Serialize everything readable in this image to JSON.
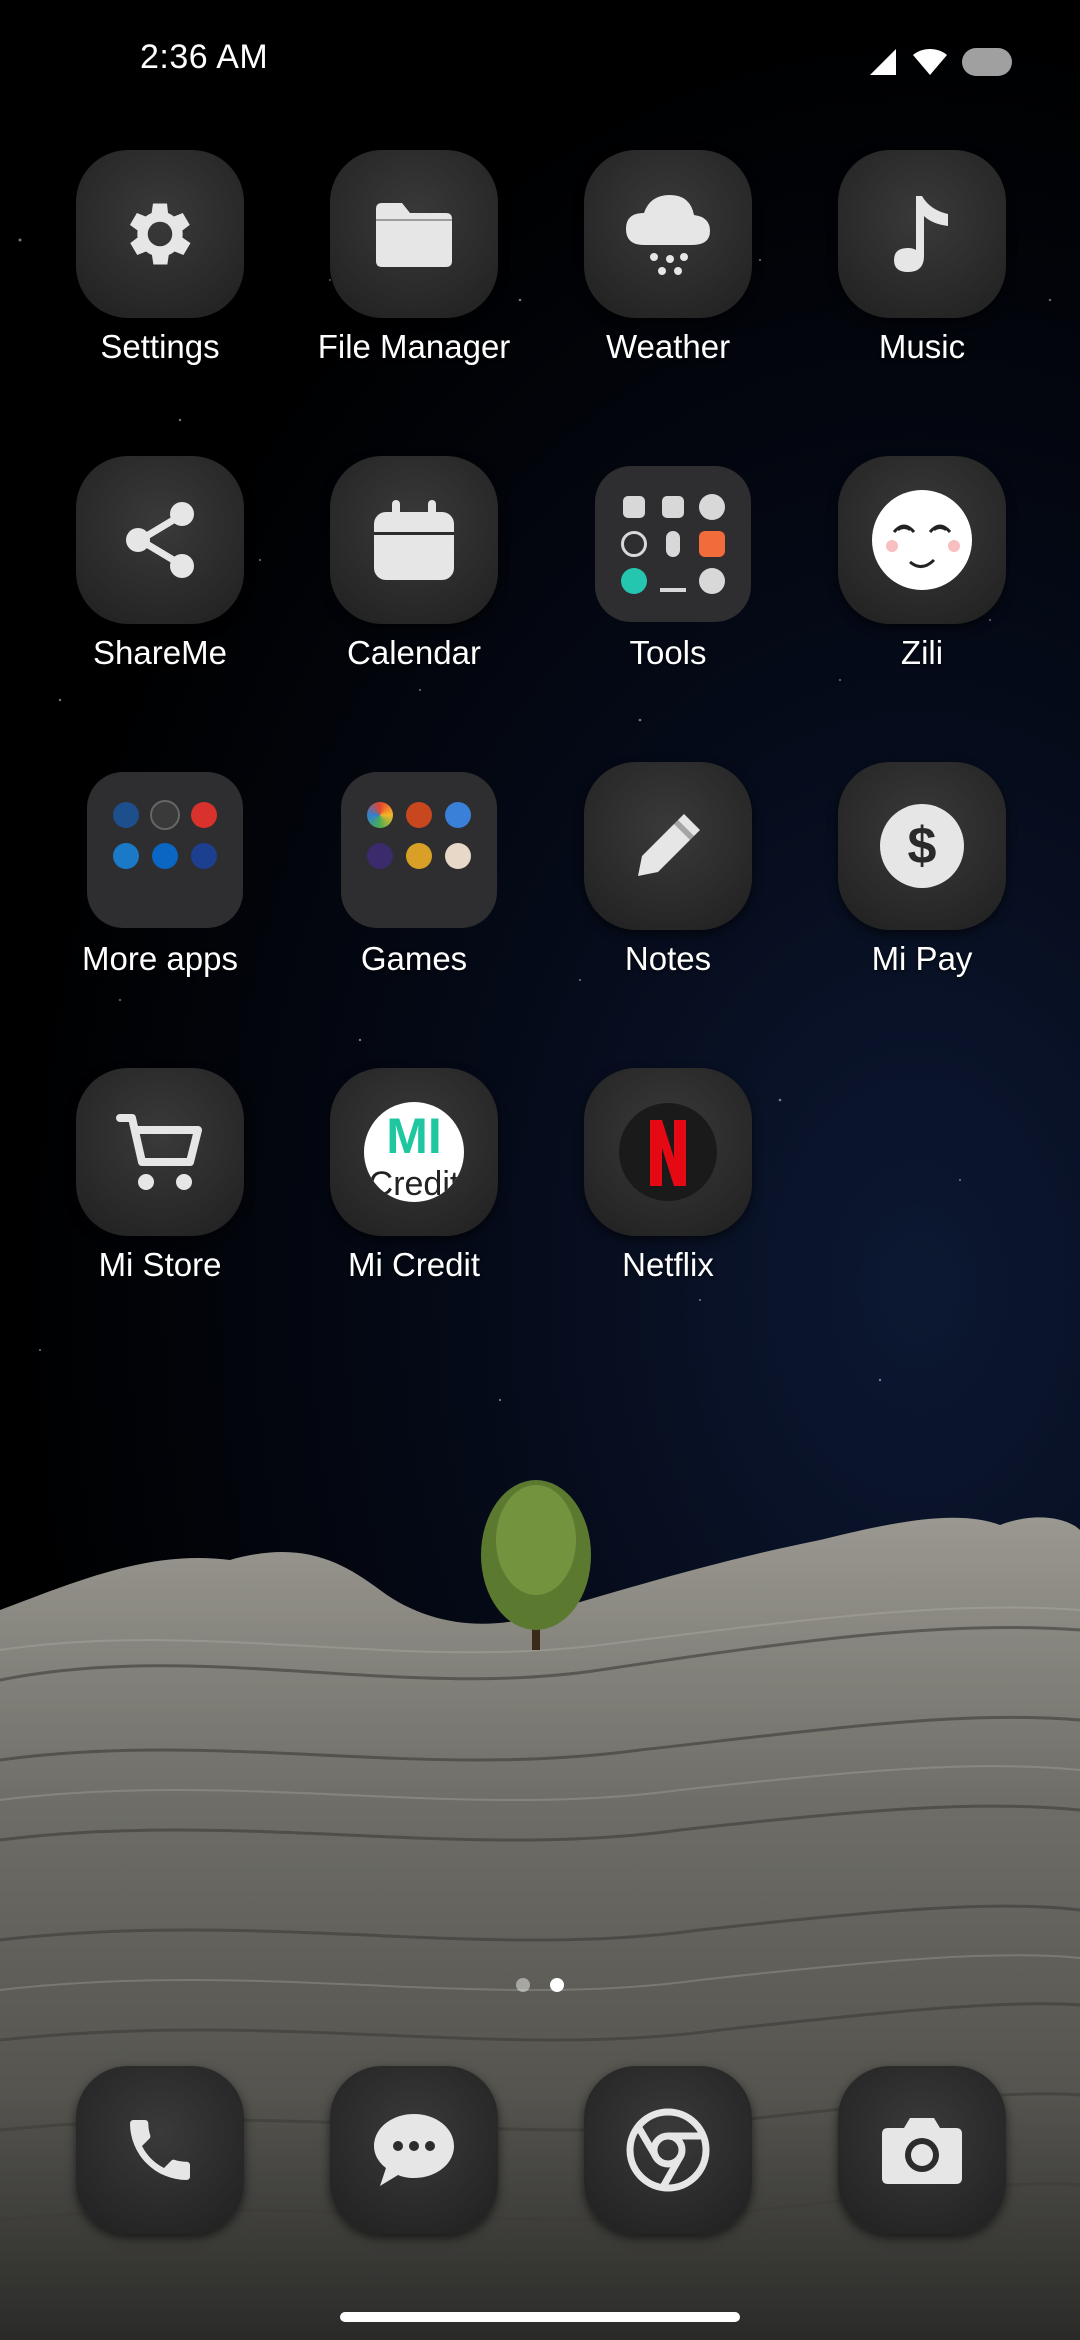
{
  "status_bar": {
    "time": "2:36 AM"
  },
  "apps": [
    {
      "name": "settings",
      "label": "Settings",
      "icon": "gear-icon"
    },
    {
      "name": "file-manager",
      "label": "File Manager",
      "icon": "folder-icon"
    },
    {
      "name": "weather",
      "label": "Weather",
      "icon": "cloud-snow-icon"
    },
    {
      "name": "music",
      "label": "Music",
      "icon": "music-note-icon"
    },
    {
      "name": "shareme",
      "label": "ShareMe",
      "icon": "share-icon"
    },
    {
      "name": "calendar",
      "label": "Calendar",
      "icon": "calendar-icon"
    },
    {
      "name": "tools",
      "label": "Tools",
      "icon": "tools-folder-icon"
    },
    {
      "name": "zili",
      "label": "Zili",
      "icon": "smiley-face-icon"
    },
    {
      "name": "more-apps",
      "label": "More apps",
      "icon": "apps-folder-icon"
    },
    {
      "name": "games",
      "label": "Games",
      "icon": "games-folder-icon"
    },
    {
      "name": "notes",
      "label": "Notes",
      "icon": "pencil-icon"
    },
    {
      "name": "mi-pay",
      "label": "Mi Pay",
      "icon": "dollar-icon"
    },
    {
      "name": "mi-store",
      "label": "Mi Store",
      "icon": "cart-icon"
    },
    {
      "name": "mi-credit",
      "label": "Mi Credit",
      "icon": "mi-credit-logo-icon"
    },
    {
      "name": "netflix",
      "label": "Netflix",
      "icon": "netflix-logo-icon"
    }
  ],
  "mi_credit_logo_text": "Mi Credit",
  "netflix_logo_text": "N",
  "page_indicator": {
    "count": 2,
    "active": 2
  },
  "dock": [
    {
      "name": "phone",
      "icon": "phone-icon"
    },
    {
      "name": "messages",
      "icon": "chat-bubble-icon"
    },
    {
      "name": "chrome",
      "icon": "chrome-icon"
    },
    {
      "name": "camera",
      "icon": "camera-icon"
    }
  ]
}
